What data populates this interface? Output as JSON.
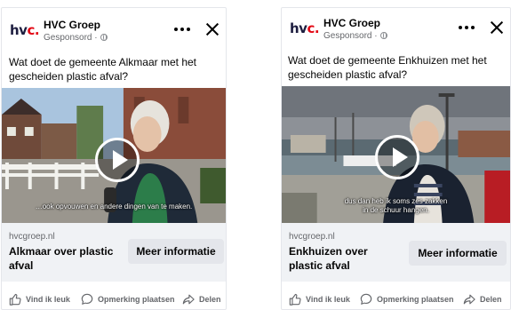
{
  "ads": [
    {
      "advertiser": "HVC Groep",
      "logo": {
        "main": "hv",
        "accent": "c."
      },
      "sponsored": "Gesponsord ·",
      "text": "Wat doet de gemeente Alkmaar met het gescheiden plastic afval?",
      "video_subtitle": "…ook opvouwen en andere dingen van te maken.",
      "domain": "hvcgroep.nl",
      "headline": "Alkmaar over plastic afval",
      "cta_label": "Meer informatie"
    },
    {
      "advertiser": "HVC Groep",
      "logo": {
        "main": "hv",
        "accent": "c."
      },
      "sponsored": "Gesponsord ·",
      "text": "Wat doet de gemeente Enkhuizen met het gescheiden plastic afval?",
      "video_subtitle": "dus dan heb ik soms zes zakken in de schuur hangen.",
      "domain": "hvcgroep.nl",
      "headline": "Enkhuizen over plastic afval",
      "cta_label": "Meer informatie"
    }
  ],
  "actions": {
    "like": "Vind ik leuk",
    "comment": "Opmerking plaatsen",
    "share": "Delen"
  },
  "colors": {
    "brand_red": "#e30613",
    "brand_dark": "#1d1d3f",
    "secondary_text": "#65676b",
    "cta_background": "#e4e6eb"
  },
  "icons": [
    "globe-icon",
    "more-icon",
    "close-icon",
    "play-icon",
    "like-icon",
    "comment-icon",
    "share-icon"
  ]
}
